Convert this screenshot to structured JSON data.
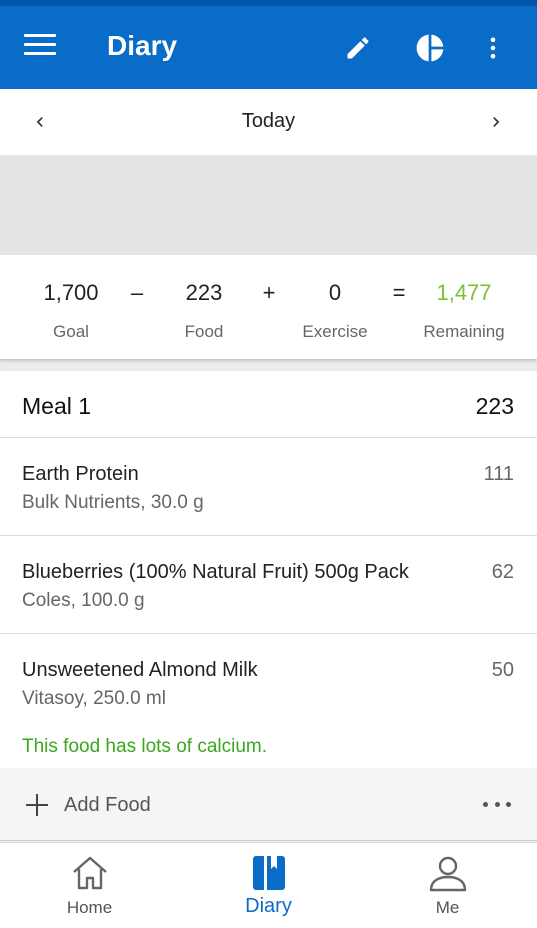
{
  "app_bar": {
    "title": "Diary",
    "icons": [
      "menu-icon",
      "pencil-icon",
      "pie-chart-icon",
      "more-vert-icon"
    ]
  },
  "date_nav": {
    "label": "Today",
    "icons": [
      "chevron-left-icon",
      "chevron-right-icon"
    ]
  },
  "summary": {
    "goal": {
      "value": "1,700",
      "label": "Goal"
    },
    "minus": "–",
    "food": {
      "value": "223",
      "label": "Food"
    },
    "plus": "+",
    "exercise": {
      "value": "0",
      "label": "Exercise"
    },
    "equals": "=",
    "remaining": {
      "value": "1,477",
      "label": "Remaining"
    },
    "remaining_color": "#7ac231"
  },
  "meal": {
    "name": "Meal 1",
    "calories": "223",
    "items": [
      {
        "name": "Earth Protein",
        "desc": "Bulk Nutrients, 30.0 g",
        "calories": "111",
        "note": ""
      },
      {
        "name": "Blueberries (100% Natural Fruit) 500g Pack",
        "desc": "Coles, 100.0 g",
        "calories": "62",
        "note": ""
      },
      {
        "name": "Unsweetened Almond Milk",
        "desc": "Vitasoy, 250.0 ml",
        "calories": "50",
        "note": "This food has lots of calcium."
      }
    ],
    "add_food_label": "Add Food"
  },
  "bottom_nav": {
    "tabs": [
      {
        "label": "Home",
        "icon": "home-icon",
        "active": false
      },
      {
        "label": "Diary",
        "icon": "diary-book-icon",
        "active": true
      },
      {
        "label": "Me",
        "icon": "person-icon",
        "active": false
      }
    ]
  },
  "colors": {
    "primary": "#0a6cc9",
    "accent_green": "#7ac231",
    "note_green": "#3aa61e"
  }
}
